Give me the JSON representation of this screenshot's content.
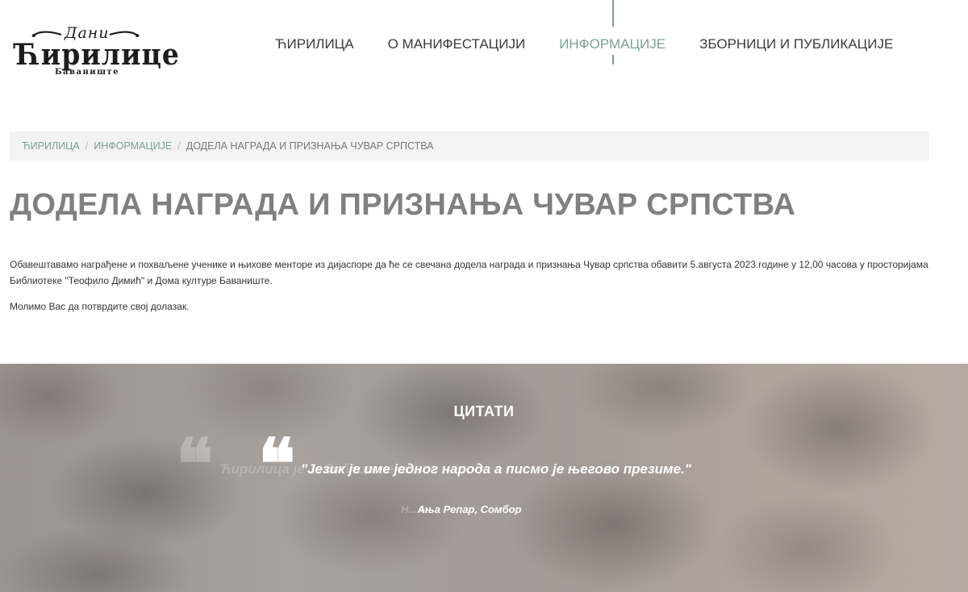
{
  "header": {
    "logo": {
      "top": "Дани",
      "main": "Ћирилице",
      "sub": "Баваниште"
    },
    "nav": [
      {
        "label": "ЋИРИЛИЦА",
        "active": false
      },
      {
        "label": "О МАНИФЕСТАЦИЈИ",
        "active": false
      },
      {
        "label": "ИНФОРМАЦИЈЕ",
        "active": true
      },
      {
        "label": "ЗБОРНИЦИ И ПУБЛИКАЦИЈЕ",
        "active": false
      }
    ]
  },
  "breadcrumb": {
    "items": [
      "ЋИРИЛИЦА",
      "ИНФОРМАЦИЈЕ"
    ],
    "separator": "/",
    "current": "ДОДЕЛА НАГРАДА И ПРИЗНАЊА ЧУВАР СРПСТВА"
  },
  "page": {
    "title": "ДОДЕЛА НАГРАДА И ПРИЗНАЊА ЧУВАР СРПСТВА",
    "paragraphs": [
      "Обавештавамо награђене и похваљене ученике и њихове менторе из дијаспоре да ће се свечана додела награда и признања Чувар српства обавити 5.августа 2023.године у 12,00 часова у просторијама Библиотеке \"Теофило Димић\" и Дома културе Баваниште.",
      "Молимо Вас да потврдите свој долазак."
    ]
  },
  "quotes": {
    "title": "ЦИТАТИ",
    "mark": "❝",
    "current": {
      "text": "\"Језик је име једног народа а писмо је његово презиме.\"",
      "author": "Ања Репар, Сомбор"
    },
    "ghost": {
      "text": "Ћирилица је ... библиотека...",
      "author": "Н... н"
    }
  },
  "colors": {
    "accent": "#7b9f91",
    "title": "#808080",
    "breadcrumb_bg": "#f3f3f3"
  }
}
